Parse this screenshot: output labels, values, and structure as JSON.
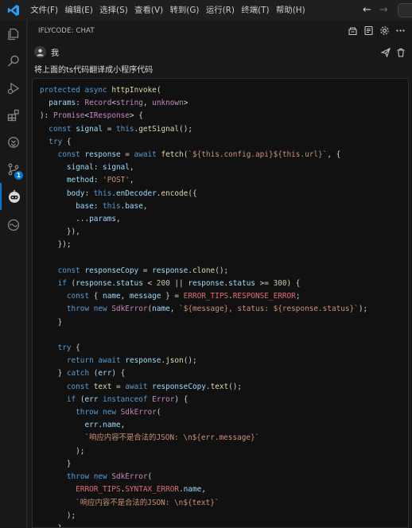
{
  "menu": [
    "文件(F)",
    "编辑(E)",
    "选择(S)",
    "查看(V)",
    "转到(G)",
    "运行(R)",
    "终端(T)",
    "帮助(H)"
  ],
  "activity_bar": {
    "items": [
      "explorer-icon",
      "search-icon",
      "run-debug-icon",
      "extensions-icon",
      "remote-icon",
      "source-control-icon",
      "iflycode-icon",
      "timeline-icon"
    ],
    "source_control_badge": "1"
  },
  "panel": {
    "title": "IFLYCODE: CHAT",
    "actions": [
      "clear-icon",
      "history-icon",
      "settings-icon",
      "more-icon"
    ]
  },
  "message": {
    "user": "我",
    "text": "将上面的ts代码翻译成小程序代码",
    "actions": [
      "send-icon",
      "delete-icon"
    ]
  },
  "code_lines": [
    "protected async httpInvoke(",
    "  params: Record<string, unknown>",
    "): Promise<IResponse> {",
    "  const signal = this.getSignal();",
    "  try {",
    "    const response = await fetch(`${this.config.api}${this.url}`, {",
    "      signal: signal,",
    "      method: 'POST',",
    "      body: this.enDecoder.encode({",
    "        base: this.base,",
    "        ...params,",
    "      }),",
    "    });",
    "",
    "    const responseCopy = response.clone();",
    "    if (response.status < 200 || response.status >= 300) {",
    "      const { name, message } = ERROR_TIPS.RESPONSE_ERROR;",
    "      throw new SdkError(name, `${message}, status: ${response.status}`);",
    "    }",
    "",
    "    try {",
    "      return await response.json();",
    "    } catch (err) {",
    "      const text = await responseCopy.text();",
    "      if (err instanceof Error) {",
    "        throw new SdkError(",
    "          err.name,",
    "          `响应内容不是合法的JSON: \\n${err.message}`",
    "        );",
    "      }",
    "      throw new SdkError(",
    "        ERROR_TIPS.SYNTAX_ERROR.name,",
    "        `响应内容不是合法的JSON: \\n${text}`",
    "      );",
    "    }"
  ]
}
